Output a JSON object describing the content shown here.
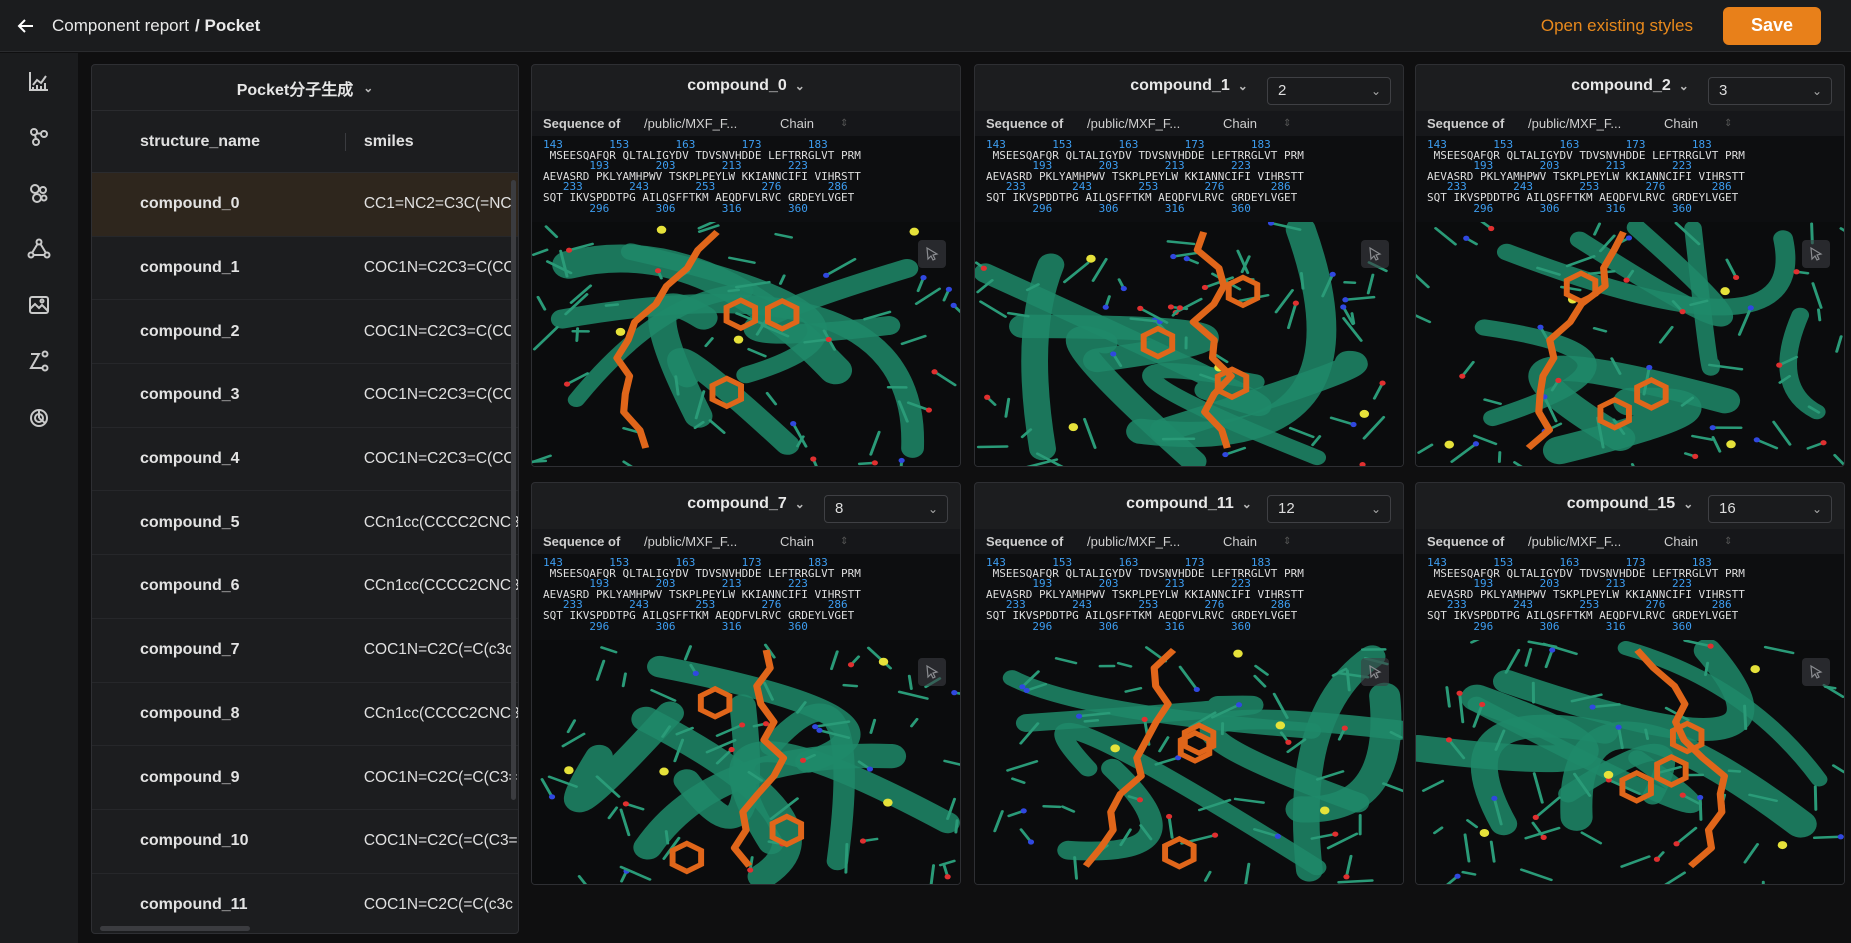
{
  "header": {
    "title": "Component report",
    "subtitle": "/ Pocket",
    "open_styles": "Open existing styles",
    "save": "Save"
  },
  "sidebar": {
    "icons": [
      "line-chart-icon",
      "molecule-icon",
      "cluster-icon",
      "network-icon",
      "image-icon",
      "flow-icon",
      "pie-chart-icon"
    ]
  },
  "table": {
    "dropdown_label": "Pocket分子生成",
    "columns": [
      "structure_name",
      "smiles"
    ],
    "rows": [
      {
        "name": "compound_0",
        "smiles": "CC1=NC2=C3C(=NC"
      },
      {
        "name": "compound_1",
        "smiles": "COC1N=C2C3=C(CC"
      },
      {
        "name": "compound_2",
        "smiles": "COC1N=C2C3=C(CC"
      },
      {
        "name": "compound_3",
        "smiles": "COC1N=C2C3=C(CC"
      },
      {
        "name": "compound_4",
        "smiles": "COC1N=C2C3=C(CC"
      },
      {
        "name": "compound_5",
        "smiles": "CCn1cc(CCCC2CNC3="
      },
      {
        "name": "compound_6",
        "smiles": "CCn1cc(CCCC2CNC3="
      },
      {
        "name": "compound_7",
        "smiles": "COC1N=C2C(=C(c3c"
      },
      {
        "name": "compound_8",
        "smiles": "CCn1cc(CCCC2CNC3="
      },
      {
        "name": "compound_9",
        "smiles": "COC1N=C2C(=C(C3="
      },
      {
        "name": "compound_10",
        "smiles": "COC1N=C2C(=C(C3="
      },
      {
        "name": "compound_11",
        "smiles": "COC1N=C2C(=C(c3c"
      }
    ]
  },
  "sequence": {
    "label": "Sequence of",
    "path": "/public/MXF_F...",
    "chain": "Chain",
    "line1_nums": "143       153       163       173       183",
    "line1_seq": " MSEESQAFQR QLTALIGYDV TDVSNVHDDE LEFTRRGLVT PRM",
    "line2_nums": "       193       203       213       223",
    "line2_seq": "AEVASRD PKLYAMHPWV TSKPLPEYLW KKIANNCIFI VIHRSTT",
    "line3_nums": "   233       243       253       276       286",
    "line3_seq": "SQT IKVSPDDTPG AILQSFFTKM AEQDFVLRVC GRDEYLVGET",
    "line4_nums": "       296       306       316       360"
  },
  "viewers": [
    {
      "title": "compound_0",
      "select": null
    },
    {
      "title": "compound_1",
      "select": "2"
    },
    {
      "title": "compound_2",
      "select": "3"
    },
    {
      "title": "compound_7",
      "select": "8"
    },
    {
      "title": "compound_11",
      "select": "12"
    },
    {
      "title": "compound_15",
      "select": "16"
    }
  ],
  "colors": {
    "accent": "#e8801a",
    "protein": "#1f8a6a",
    "ligand": "#e0661a",
    "background": "#0f0f10"
  }
}
